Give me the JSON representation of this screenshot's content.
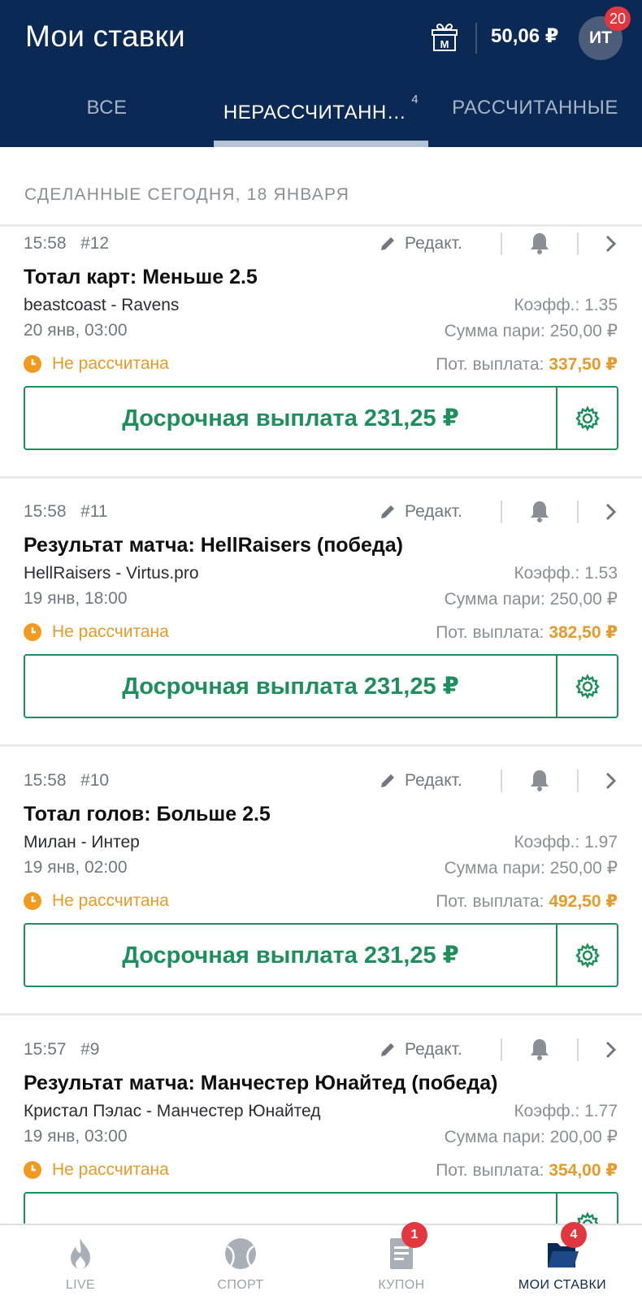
{
  "header": {
    "title": "Мои ставки",
    "gift_letter": "М",
    "balance": "50,06 ₽",
    "avatar_initials": "ИТ",
    "avatar_badge": "20"
  },
  "tabs": [
    {
      "label": "ВСЕ",
      "active": false
    },
    {
      "label": "НЕРАССЧИТАНН…",
      "count": "4",
      "active": true
    },
    {
      "label": "РАССЧИТАННЫЕ",
      "active": false
    }
  ],
  "section_title": "СДЕЛАННЫЕ СЕГОДНЯ, 18 ЯНВАРЯ",
  "edit_label": "Редакт.",
  "bets": [
    {
      "time": "15:58",
      "number": "#12",
      "market": "Тотал карт: Меньше 2.5",
      "teams": "beastcoast - Ravens",
      "event_date": "20 янв, 03:00",
      "odds": "Коэфф.: 1.35",
      "stake": "Сумма пари: 250,00 ₽",
      "status": "Не рассчитана",
      "payout_label": "Пот. выплата:",
      "payout_value": "337,50 ₽",
      "cashout": "Досрочная выплата 231,25 ₽"
    },
    {
      "time": "15:58",
      "number": "#11",
      "market": "Результат матча: HellRaisers (победа)",
      "teams": "HellRaisers - Virtus.pro",
      "event_date": "19 янв, 18:00",
      "odds": "Коэфф.: 1.53",
      "stake": "Сумма пари: 250,00 ₽",
      "status": "Не рассчитана",
      "payout_label": "Пот. выплата:",
      "payout_value": "382,50 ₽",
      "cashout": "Досрочная выплата 231,25 ₽"
    },
    {
      "time": "15:58",
      "number": "#10",
      "market": "Тотал голов: Больше 2.5",
      "teams": "Милан - Интер",
      "event_date": "19 янв, 02:00",
      "odds": "Коэфф.: 1.97",
      "stake": "Сумма пари: 250,00 ₽",
      "status": "Не рассчитана",
      "payout_label": "Пот. выплата:",
      "payout_value": "492,50 ₽",
      "cashout": "Досрочная выплата 231,25 ₽"
    },
    {
      "time": "15:57",
      "number": "#9",
      "market": "Результат матча: Манчестер Юнайтед (победа)",
      "teams": "Кристал Пэлас - Манчестер Юнайтед",
      "event_date": "19 янв, 03:00",
      "odds": "Коэфф.: 1.77",
      "stake": "Сумма пари: 200,00 ₽",
      "status": "Не рассчитана",
      "payout_label": "Пот. выплата:",
      "payout_value": "354,00 ₽",
      "cashout": ""
    }
  ],
  "bottom_nav": [
    {
      "label": "LIVE",
      "icon": "flame-icon"
    },
    {
      "label": "СПОРТ",
      "icon": "ball-icon"
    },
    {
      "label": "КУПОН",
      "icon": "coupon-icon",
      "badge": "1"
    },
    {
      "label": "МОИ СТАВКИ",
      "icon": "folder-icon",
      "badge": "4",
      "active": true
    }
  ],
  "colors": {
    "header_bg": "#0b2955",
    "accent_green": "#1e8e5c",
    "status_orange": "#e59a2a",
    "badge_red": "#e2373f"
  }
}
